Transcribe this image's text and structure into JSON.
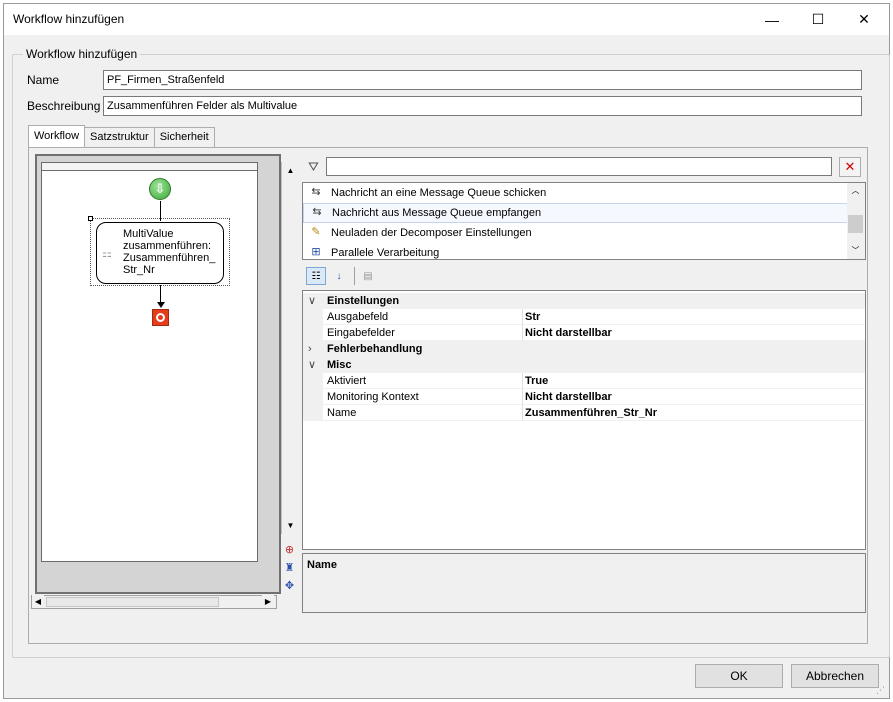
{
  "window": {
    "title": "Workflow hinzufügen",
    "controls": {
      "minimize": "—",
      "maximize": "☐",
      "close": "✕"
    }
  },
  "group": {
    "label": "Workflow hinzufügen"
  },
  "form": {
    "name_label": "Name",
    "name_value": "PF_Firmen_Straßenfeld",
    "description_label": "Beschreibung",
    "description_value": "Zusammenführen Felder als Multivalue"
  },
  "tabs": [
    {
      "label": "Workflow",
      "active": true
    },
    {
      "label": "Satzstruktur",
      "active": false
    },
    {
      "label": "Sicherheit",
      "active": false
    }
  ],
  "designer": {
    "start_icon": "arrow-down-circle-icon",
    "activity_label": "MultiValue\nzusammenführen:\nZusammenführen_\nStr_Nr",
    "stop_icon": "stop-icon"
  },
  "palette": {
    "filter_value": "",
    "items": [
      {
        "label": "Nachricht an eine Message Queue schicken",
        "icon": "queue-send-icon",
        "selected": false
      },
      {
        "label": "Nachricht aus Message Queue empfangen",
        "icon": "queue-receive-icon",
        "selected": true
      },
      {
        "label": "Neuladen der Decomposer Einstellungen",
        "icon": "reload-icon",
        "selected": false
      },
      {
        "label": "Parallele Verarbeitung",
        "icon": "parallel-icon",
        "selected": false
      }
    ]
  },
  "properties": {
    "categories": [
      {
        "name": "Einstellungen",
        "expanded": true,
        "props": [
          {
            "name": "Ausgabefeld",
            "value": "Str"
          },
          {
            "name": "Eingabefelder",
            "value": "Nicht darstellbar"
          }
        ]
      },
      {
        "name": "Fehlerbehandlung",
        "expanded": false,
        "props": []
      },
      {
        "name": "Misc",
        "expanded": true,
        "props": [
          {
            "name": "Aktiviert",
            "value": "True"
          },
          {
            "name": "Monitoring Kontext",
            "value": "Nicht darstellbar"
          },
          {
            "name": "Name",
            "value": "Zusammenführen_Str_Nr"
          }
        ]
      }
    ],
    "description_title": "Name"
  },
  "buttons": {
    "ok": "OK",
    "cancel": "Abbrechen"
  }
}
